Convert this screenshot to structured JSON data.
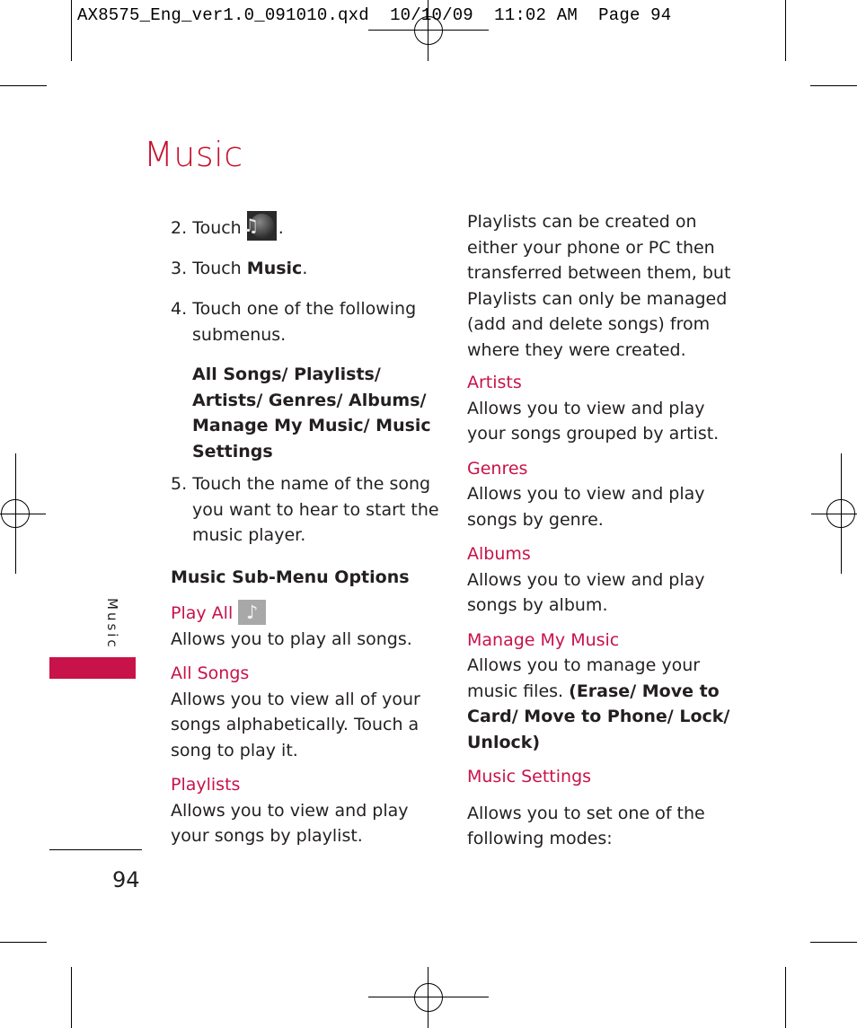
{
  "slug": {
    "file_name": "AX8575_Eng_ver1.0_091010.qxd",
    "date": "10/10/09",
    "time": "11:02 AM",
    "page_label": "Page 94"
  },
  "page": {
    "title": "Music",
    "side_tab_label": "Music",
    "page_number": "94"
  },
  "left_column": {
    "steps": [
      {
        "number": "2.",
        "text_before": "Touch",
        "icon": "music-app-icon",
        "text_after": "."
      },
      {
        "number": "3.",
        "text_before": "Touch",
        "bold": "Music",
        "text_after": "."
      },
      {
        "number": "4.",
        "text": "Touch one of the following submenus."
      }
    ],
    "submenus_bold": "All Songs/ Playlists/ Artists/ Genres/ Albums/ Manage My Music/ Music Settings",
    "step5": {
      "number": "5.",
      "text": "Touch the name of the song you want to hear to start the music player."
    },
    "section_heading": "Music Sub-Menu Options",
    "options": [
      {
        "title": "Play All",
        "icon": "music-note-icon",
        "description": "Allows you to play all songs."
      },
      {
        "title": "All Songs",
        "description": "Allows you to view all of your songs alphabetically. Touch a song to play it."
      },
      {
        "title": "Playlists",
        "description": "Allows you to view and play your songs by playlist."
      }
    ]
  },
  "right_column": {
    "intro": "Playlists can be created on either your phone or PC then transferred between them, but Playlists can only be managed (add and delete songs) from where they were created.",
    "options": [
      {
        "title": "Artists",
        "description": "Allows you to view and play your songs grouped by artist."
      },
      {
        "title": "Genres",
        "description": "Allows you to view and play songs by genre."
      },
      {
        "title": "Albums",
        "description": "Allows you to view and play songs by album."
      },
      {
        "title": "Manage My Music",
        "description": "Allows you to manage your music files.",
        "bold_options": "(Erase/ Move to Card/ Move to Phone/ Lock/ Unlock)"
      },
      {
        "title": "Music Settings",
        "description": "Allows you to set one of the following modes:"
      }
    ]
  },
  "colors": {
    "accent": "#c8124a",
    "text": "#231f20"
  }
}
